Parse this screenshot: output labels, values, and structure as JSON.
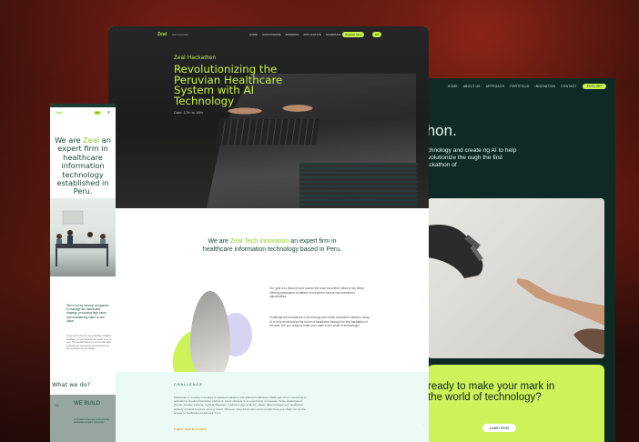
{
  "right": {
    "nav": [
      "HOME",
      "ABOUT US",
      "APPROACH",
      "PORTFOLIO",
      "INNOVATION",
      "CONTACT"
    ],
    "lang": "ENGLISH",
    "hero_title": "thon.",
    "hero_text": "technology and create ng AI to help revolutionize the ough the first hackathon of",
    "cta_title": "ready to make your mark in the world of technology?",
    "cta_button": "Learn more"
  },
  "center": {
    "logo": "Zeal",
    "logo_sub": "Tech Innovation",
    "nav": [
      "HOME",
      "HACKATHONS",
      "MISSIONS",
      "APPLICATION",
      "SCHEDULE",
      "FAQ"
    ],
    "register": "Register here",
    "lang": "EN",
    "eyebrow": "Zeal Hackathon",
    "title": "Revolutionizing the Peruvian Healthcare System with AI Technology",
    "date": "Date: 17th to 18th",
    "we_are_prefix": "We are ",
    "we_are_hl": "Zeal Tech Innovation",
    "we_are_suffix": " an expert firm in healthcare information technology based in Peru.",
    "text1": "Our goal is to discover and nurture the most innovative ideas in key fields, offering participants a platform to transform visions into investment opportunities.",
    "text2": "Challenge the boundaries of technology and create innovative solutions using AI to help revolutionize the future of healthcare through the first hackathon of the year. Are you ready to make your mark in the world of technology?",
    "challenge_title": "CHALLENGE",
    "challenge_text": "Participate in creating innovative AI-assisted solutions that address healthcare challenges. From monitoring to assistant to creating interactive platforms, every obstacle is an opportunity to innovate. Solve challenges in chronic disease tracking, medical diagnosis, medical image analysis, patient data management, healthcare delivery, medical services, among others. Discover more information and consider how your ideas can be the answer to healthcare problems in Peru.",
    "challenge_link": "Explore more information"
  },
  "mobile": {
    "logo": "Zeal",
    "lang": "EN",
    "hero_prefix": "We are ",
    "hero_hl": "Zeal",
    "hero_suffix": " an expert firm in healthcare information technology established in Peru.",
    "text1": "We're led by several companies to manage the distributed strategy, producing high value and maintaining value in one place.",
    "text2": "If you don't you for me priorities. Patient academy of you that be for each one of you. You would have to rent a new idea to know we can join to do long term to the success of you today.",
    "what": "What we do?",
    "card_num": "01",
    "card_title": "WE BUILD",
    "card_text": "Technical know-how products that automate complex processes"
  },
  "colors": {
    "accent": "#c6f04a",
    "dark_green": "#0f2a25",
    "text_green": "#1b4a3b"
  }
}
